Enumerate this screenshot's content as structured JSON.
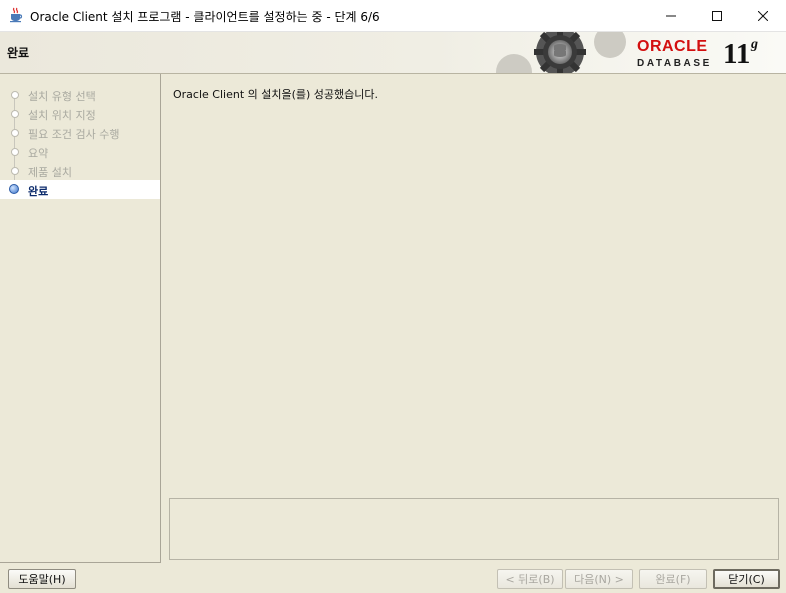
{
  "window": {
    "title": "Oracle Client 설치 프로그램 - 클라이언트를 설정하는 중 - 단계 6/6"
  },
  "header": {
    "title": "완료",
    "brand_oracle": "ORACLE",
    "brand_database": "DATABASE",
    "brand_version": "11",
    "brand_version_suffix": "g",
    "brand_color": "#d30f0f"
  },
  "steps": [
    {
      "label": "설치 유형 선택",
      "state": "done"
    },
    {
      "label": "설치 위치 지정",
      "state": "done"
    },
    {
      "label": "필요 조건 검사 수행",
      "state": "done"
    },
    {
      "label": "요약",
      "state": "done"
    },
    {
      "label": "제품 설치",
      "state": "done"
    },
    {
      "label": "완료",
      "state": "active"
    }
  ],
  "content": {
    "message": "Oracle Client 의 설치을(를) 성공했습니다."
  },
  "buttons": {
    "help": "도움말(H)",
    "back": "< 뒤로(B)",
    "next": "다음(N) >",
    "finish": "완료(F)",
    "close": "닫기(C)"
  },
  "icons": {
    "app": "java-cup-icon",
    "minimize": "minimize-icon",
    "maximize": "maximize-icon",
    "close": "close-icon",
    "step_marker": "step-dot-icon",
    "banner": "gears-icon"
  }
}
